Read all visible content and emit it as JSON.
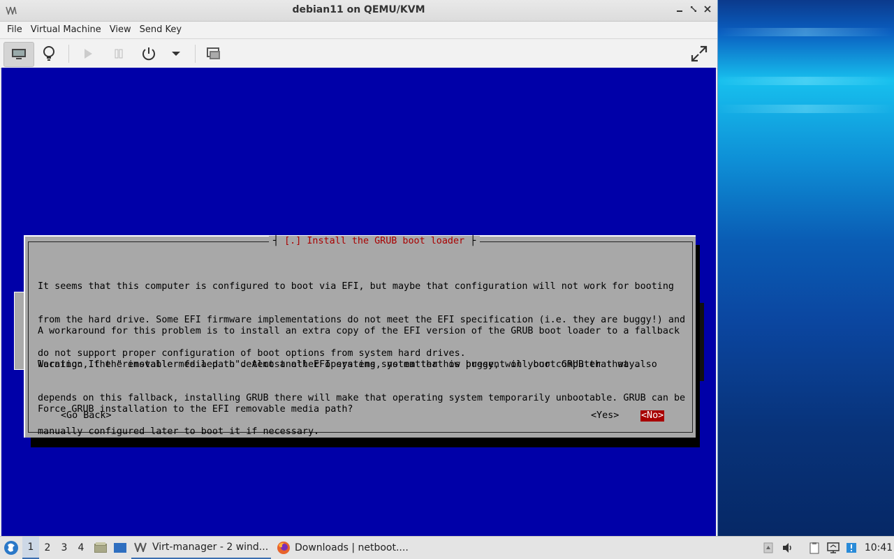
{
  "window": {
    "title": "debian11 on QEMU/KVM",
    "menu": [
      "File",
      "Virtual Machine",
      "View",
      "Send Key"
    ]
  },
  "toolbar": {
    "buttons": [
      "console-view",
      "details-view",
      "run",
      "pause",
      "shutdown",
      "shutdown-menu",
      "snapshots",
      "fullscreen"
    ]
  },
  "installer": {
    "dialog_title": "[.] Install the GRUB boot loader",
    "paragraphs": [
      [
        "It seems that this computer is configured to boot via EFI, but maybe that configuration will not work for booting",
        "from the hard drive. Some EFI firmware implementations do not meet the EFI specification (i.e. they are buggy!) and",
        "do not support proper configuration of boot options from system hard drives."
      ],
      [
        "A workaround for this problem is to install an extra copy of the EFI version of the GRUB boot loader to a fallback",
        "location, the \"removable media path\". Almost all EFI systems, no matter how buggy, will boot GRUB that way."
      ],
      [
        "Warning: If the installer failed to detect another operating system that is present on your computer that also",
        "depends on this fallback, installing GRUB there will make that operating system temporarily unbootable. GRUB can be",
        "manually configured later to boot it if necessary."
      ],
      [
        "Force GRUB installation to the EFI removable media path?"
      ]
    ],
    "go_back": "<Go Back>",
    "yes": "<Yes>",
    "no": "<No>",
    "selected": "no"
  },
  "taskbar": {
    "workspaces": [
      "1",
      "2",
      "3",
      "4"
    ],
    "current_workspace": "1",
    "tasks": [
      {
        "label": "Virt-manager - 2 wind...",
        "icon": "virt-manager-icon",
        "active": true
      },
      {
        "label": "Downloads | netboot....",
        "icon": "firefox-icon",
        "active": false
      }
    ],
    "clock": "10:41"
  },
  "colors": {
    "console_bg": "#0000a8",
    "dialog_bg": "#a8a8a8",
    "title_red": "#a80000",
    "selected_button_bg": "#a80000"
  }
}
